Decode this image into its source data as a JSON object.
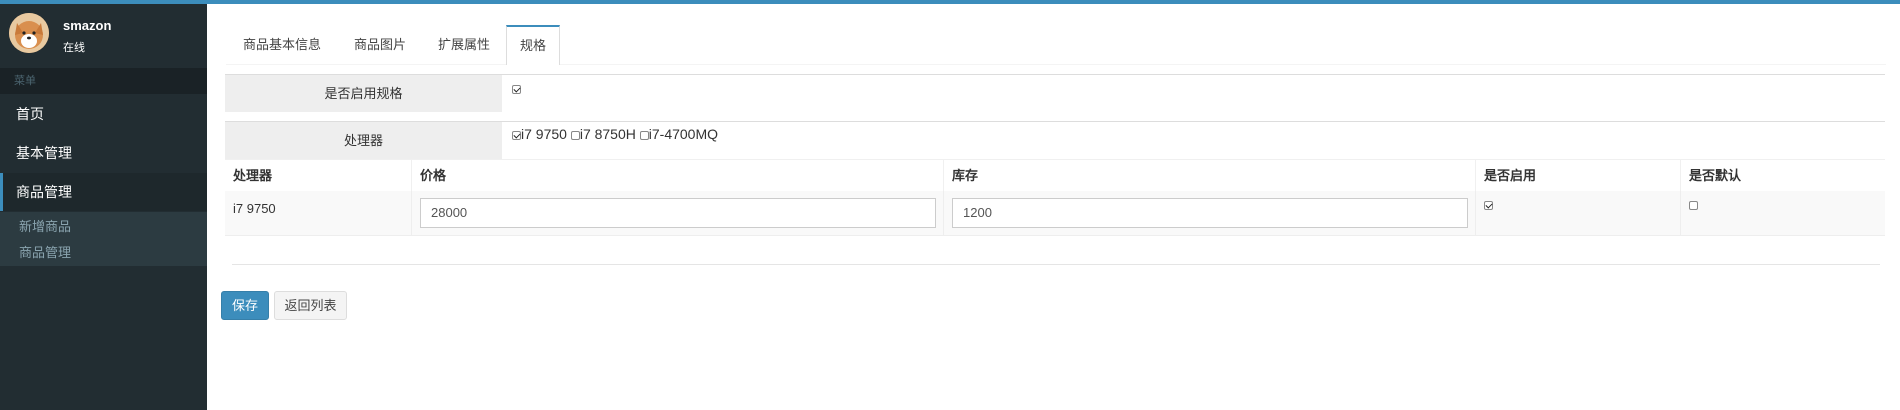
{
  "user": {
    "name": "smazon",
    "status": "在线"
  },
  "sidebar": {
    "header": "菜单",
    "items": [
      {
        "label": "首页"
      },
      {
        "label": "基本管理"
      },
      {
        "label": "商品管理"
      }
    ],
    "subitems": [
      {
        "label": "新增商品"
      },
      {
        "label": "商品管理"
      }
    ]
  },
  "tabs": [
    {
      "label": "商品基本信息"
    },
    {
      "label": "商品图片"
    },
    {
      "label": "扩展属性"
    },
    {
      "label": "规格",
      "active": true
    }
  ],
  "spec": {
    "enable_label": "是否启用规格",
    "enable_checked": true,
    "processor_label": "处理器",
    "options": [
      {
        "label": "i7 9750",
        "checked": true
      },
      {
        "label": "i7 8750H",
        "checked": false
      },
      {
        "label": "i7-4700MQ",
        "checked": false
      }
    ]
  },
  "sku_table": {
    "headers": [
      "处理器",
      "价格",
      "库存",
      "是否启用",
      "是否默认"
    ],
    "rows": [
      {
        "processor": "i7 9750",
        "price": "28000",
        "stock": "1200",
        "enabled": true,
        "default": false
      }
    ]
  },
  "buttons": {
    "save": "保存",
    "back": "返回列表"
  },
  "colors": {
    "accent": "#3c8dbc",
    "sidebar": "#222d32"
  }
}
